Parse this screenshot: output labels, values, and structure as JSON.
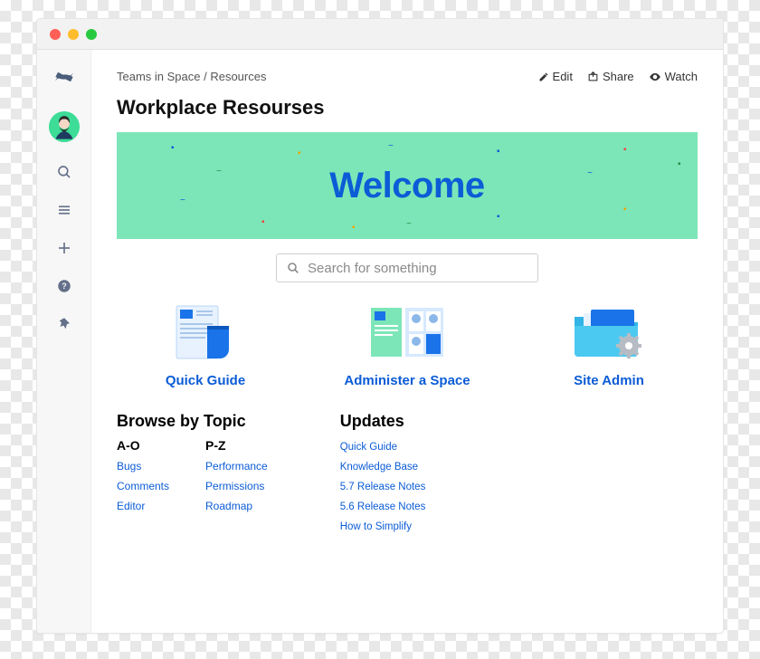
{
  "breadcrumb": "Teams in Space / Resources",
  "actions": {
    "edit": "Edit",
    "share": "Share",
    "watch": "Watch"
  },
  "page_title": "Workplace Resourses",
  "banner_text": "Welcome",
  "search_placeholder": "Search for something",
  "cards": [
    {
      "label": "Quick Guide"
    },
    {
      "label": "Administer a Space"
    },
    {
      "label": "Site Admin"
    }
  ],
  "browse": {
    "title": "Browse by Topic",
    "col_a_head": "A-O",
    "col_a": [
      "Bugs",
      "Comments",
      "Editor"
    ],
    "col_b_head": "P-Z",
    "col_b": [
      "Performance",
      "Permissions",
      "Roadmap"
    ]
  },
  "updates": {
    "title": "Updates",
    "items": [
      "Quick Guide",
      "Knowledge Base",
      "5.7 Release Notes",
      "5.6 Release Notes",
      "How to Simplify"
    ]
  }
}
